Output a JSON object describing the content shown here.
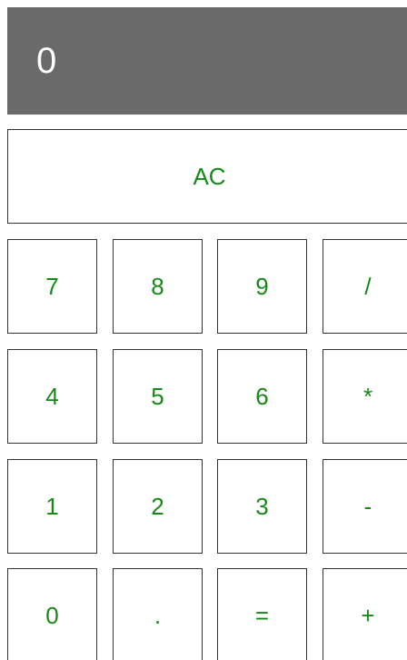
{
  "display": {
    "value": "0"
  },
  "buttons": {
    "clear": "AC",
    "row1": [
      "7",
      "8",
      "9",
      "/"
    ],
    "row2": [
      "4",
      "5",
      "6",
      "*"
    ],
    "row3": [
      "1",
      "2",
      "3",
      "-"
    ],
    "row4": [
      "0",
      ".",
      "=",
      "+"
    ]
  },
  "colors": {
    "display_bg": "#6a6a6a",
    "display_text": "#ffffff",
    "button_text": "#168a16",
    "button_border": "#333333"
  }
}
